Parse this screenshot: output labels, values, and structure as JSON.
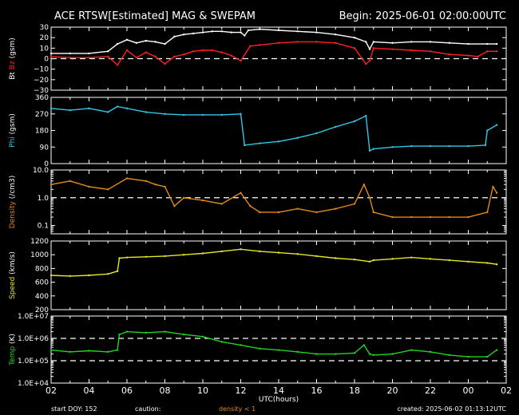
{
  "header": {
    "title": "ACE RTSW[Estimated] MAG & SWEPAM",
    "begin": "Begin: 2025-06-01 02:00:00UTC"
  },
  "footer": {
    "start": "start DOY: 152",
    "caution": "caution:",
    "caution_note": "density < 1",
    "created": "created: 2025-06-02 01:13:12UTC"
  },
  "colors": {
    "background": "#000000",
    "frame": "#ffffff",
    "bt": "#ffffff",
    "bz": "#ff2020",
    "phi": "#33c7e6",
    "density": "#e08a1a",
    "speed": "#e6e62a",
    "temp": "#22d422"
  },
  "chart_data": {
    "type": "line",
    "xlabel": "UTC(hours)",
    "xlim": [
      2,
      26
    ],
    "x_ticks": [
      "02",
      "04",
      "06",
      "08",
      "10",
      "12",
      "14",
      "16",
      "18",
      "20",
      "22",
      "00",
      "02"
    ],
    "panels": [
      {
        "id": "bt_bz",
        "ylabel_parts": [
          {
            "text": "Bt",
            "color": "#ffffff"
          },
          {
            "text": "Bz",
            "color": "#ff2020"
          },
          {
            "text": "(gsm)",
            "color": "#ffffff"
          }
        ],
        "ylim": [
          -30,
          30
        ],
        "scale": "linear",
        "ticks": [
          {
            "v": 30,
            "label": "30"
          },
          {
            "v": 20,
            "label": "20"
          },
          {
            "v": 10,
            "label": "10"
          },
          {
            "v": 0,
            "label": "0"
          },
          {
            "v": -10,
            "label": "−10"
          },
          {
            "v": -20,
            "label": "−20"
          },
          {
            "v": -30,
            "label": "−30"
          }
        ],
        "ref_lines": [
          0
        ],
        "series": [
          {
            "key": "bt",
            "color": "#ffffff",
            "points": [
              [
                2.0,
                5
              ],
              [
                3.0,
                5
              ],
              [
                4.0,
                5
              ],
              [
                5.0,
                7
              ],
              [
                5.5,
                14
              ],
              [
                6.0,
                18
              ],
              [
                6.5,
                15
              ],
              [
                7.0,
                17
              ],
              [
                7.5,
                16
              ],
              [
                8.0,
                14
              ],
              [
                8.5,
                21
              ],
              [
                9.0,
                23
              ],
              [
                9.5,
                24
              ],
              [
                10.0,
                25
              ],
              [
                10.5,
                26
              ],
              [
                11.0,
                26
              ],
              [
                11.5,
                25
              ],
              [
                12.0,
                25
              ],
              [
                12.2,
                22
              ],
              [
                12.4,
                27
              ],
              [
                13.0,
                28
              ],
              [
                14.0,
                27
              ],
              [
                15.0,
                26
              ],
              [
                16.0,
                25
              ],
              [
                17.0,
                23
              ],
              [
                18.0,
                20
              ],
              [
                18.6,
                16
              ],
              [
                18.8,
                9
              ],
              [
                19.0,
                16
              ],
              [
                20.0,
                15
              ],
              [
                21.0,
                16
              ],
              [
                22.0,
                16
              ],
              [
                23.0,
                15
              ],
              [
                24.0,
                14
              ],
              [
                25.0,
                14
              ],
              [
                25.5,
                14
              ]
            ]
          },
          {
            "key": "bz",
            "color": "#ff2020",
            "points": [
              [
                2.0,
                2
              ],
              [
                3.0,
                1
              ],
              [
                4.0,
                1
              ],
              [
                5.0,
                2
              ],
              [
                5.5,
                -6
              ],
              [
                6.0,
                8
              ],
              [
                6.5,
                1
              ],
              [
                7.0,
                6
              ],
              [
                7.5,
                2
              ],
              [
                8.0,
                -5
              ],
              [
                8.5,
                2
              ],
              [
                9.0,
                4
              ],
              [
                9.5,
                7
              ],
              [
                10.0,
                8
              ],
              [
                10.5,
                8
              ],
              [
                11.0,
                6
              ],
              [
                11.5,
                3
              ],
              [
                12.0,
                -2
              ],
              [
                12.5,
                12
              ],
              [
                13.0,
                13
              ],
              [
                14.0,
                15
              ],
              [
                15.0,
                16
              ],
              [
                16.0,
                16
              ],
              [
                17.0,
                15
              ],
              [
                18.0,
                10
              ],
              [
                18.6,
                -5
              ],
              [
                18.8,
                -2
              ],
              [
                19.0,
                10
              ],
              [
                20.0,
                9
              ],
              [
                21.0,
                8
              ],
              [
                22.0,
                7
              ],
              [
                23.0,
                4
              ],
              [
                24.0,
                3
              ],
              [
                24.5,
                2
              ],
              [
                25.0,
                7
              ],
              [
                25.5,
                7
              ]
            ]
          }
        ]
      },
      {
        "id": "phi",
        "ylabel_parts": [
          {
            "text": "Phi",
            "color": "#33c7e6"
          },
          {
            "text": "(gsm)",
            "color": "#ffffff"
          }
        ],
        "ylim": [
          0,
          360
        ],
        "scale": "linear",
        "ticks": [
          {
            "v": 360,
            "label": "360"
          },
          {
            "v": 270,
            "label": "270"
          },
          {
            "v": 180,
            "label": "180"
          },
          {
            "v": 90,
            "label": "90"
          },
          {
            "v": 0,
            "label": "0"
          }
        ],
        "ref_lines": [],
        "series": [
          {
            "key": "phi",
            "color": "#33c7e6",
            "points": [
              [
                2.0,
                300
              ],
              [
                3.0,
                290
              ],
              [
                4.0,
                300
              ],
              [
                5.0,
                280
              ],
              [
                5.5,
                310
              ],
              [
                6.0,
                300
              ],
              [
                7.0,
                280
              ],
              [
                8.0,
                270
              ],
              [
                9.0,
                265
              ],
              [
                10.0,
                265
              ],
              [
                11.0,
                265
              ],
              [
                12.0,
                270
              ],
              [
                12.2,
                100
              ],
              [
                13.0,
                110
              ],
              [
                14.0,
                120
              ],
              [
                15.0,
                140
              ],
              [
                16.0,
                165
              ],
              [
                17.0,
                200
              ],
              [
                18.0,
                230
              ],
              [
                18.6,
                260
              ],
              [
                18.8,
                70
              ],
              [
                19.0,
                80
              ],
              [
                20.0,
                90
              ],
              [
                21.0,
                95
              ],
              [
                22.0,
                95
              ],
              [
                23.0,
                95
              ],
              [
                24.0,
                95
              ],
              [
                24.9,
                100
              ],
              [
                25.0,
                180
              ],
              [
                25.5,
                210
              ]
            ]
          }
        ]
      },
      {
        "id": "density",
        "ylabel_parts": [
          {
            "text": "Density",
            "color": "#e08a1a"
          },
          {
            "text": "(/cm3)",
            "color": "#ffffff"
          }
        ],
        "ylim": [
          0.05,
          10
        ],
        "scale": "log",
        "ticks": [
          {
            "v": 10,
            "label": "10.0"
          },
          {
            "v": 1,
            "label": "1.0"
          },
          {
            "v": 0.1,
            "label": "0.1"
          }
        ],
        "ref_lines": [
          1
        ],
        "series": [
          {
            "key": "density",
            "color": "#e08a1a",
            "points": [
              [
                2.0,
                3.0
              ],
              [
                3.0,
                4.0
              ],
              [
                4.0,
                2.5
              ],
              [
                5.0,
                2.0
              ],
              [
                6.0,
                5.0
              ],
              [
                7.0,
                4.0
              ],
              [
                7.5,
                3.0
              ],
              [
                8.0,
                2.5
              ],
              [
                8.5,
                0.5
              ],
              [
                9.0,
                1.0
              ],
              [
                10.0,
                0.8
              ],
              [
                11.0,
                0.6
              ],
              [
                12.0,
                1.5
              ],
              [
                12.5,
                0.5
              ],
              [
                13.0,
                0.3
              ],
              [
                14.0,
                0.3
              ],
              [
                15.0,
                0.4
              ],
              [
                16.0,
                0.3
              ],
              [
                17.0,
                0.4
              ],
              [
                18.0,
                0.6
              ],
              [
                18.5,
                3.0
              ],
              [
                18.8,
                1.0
              ],
              [
                19.0,
                0.3
              ],
              [
                20.0,
                0.2
              ],
              [
                21.0,
                0.2
              ],
              [
                22.0,
                0.2
              ],
              [
                23.0,
                0.2
              ],
              [
                24.0,
                0.2
              ],
              [
                25.0,
                0.3
              ],
              [
                25.3,
                2.5
              ],
              [
                25.5,
                1.5
              ]
            ]
          }
        ]
      },
      {
        "id": "speed",
        "ylabel_parts": [
          {
            "text": "Speed",
            "color": "#e6e62a"
          },
          {
            "text": "(km/s)",
            "color": "#ffffff"
          }
        ],
        "ylim": [
          200,
          1200
        ],
        "scale": "linear",
        "ticks": [
          {
            "v": 1200,
            "label": "1200"
          },
          {
            "v": 1000,
            "label": "1000"
          },
          {
            "v": 800,
            "label": "800"
          },
          {
            "v": 600,
            "label": "600"
          },
          {
            "v": 400,
            "label": "400"
          },
          {
            "v": 200,
            "label": "200"
          }
        ],
        "ref_lines": [],
        "series": [
          {
            "key": "speed",
            "color": "#e6e62a",
            "points": [
              [
                2.0,
                700
              ],
              [
                3.0,
                690
              ],
              [
                4.0,
                700
              ],
              [
                5.0,
                720
              ],
              [
                5.5,
                760
              ],
              [
                5.6,
                950
              ],
              [
                6.0,
                960
              ],
              [
                7.0,
                970
              ],
              [
                8.0,
                980
              ],
              [
                9.0,
                1000
              ],
              [
                10.0,
                1020
              ],
              [
                11.0,
                1050
              ],
              [
                12.0,
                1080
              ],
              [
                13.0,
                1050
              ],
              [
                14.0,
                1030
              ],
              [
                15.0,
                1010
              ],
              [
                16.0,
                980
              ],
              [
                17.0,
                950
              ],
              [
                18.0,
                930
              ],
              [
                18.8,
                900
              ],
              [
                19.0,
                920
              ],
              [
                20.0,
                940
              ],
              [
                21.0,
                960
              ],
              [
                22.0,
                940
              ],
              [
                23.0,
                920
              ],
              [
                24.0,
                900
              ],
              [
                25.0,
                880
              ],
              [
                25.5,
                860
              ]
            ]
          }
        ]
      },
      {
        "id": "temp",
        "ylabel_parts": [
          {
            "text": "Temp",
            "color": "#22d422"
          },
          {
            "text": "(K)",
            "color": "#ffffff"
          }
        ],
        "ylim": [
          10000,
          10000000
        ],
        "scale": "log",
        "ticks": [
          {
            "v": 10000000,
            "label": "1.0E+07"
          },
          {
            "v": 1000000,
            "label": "1.0E+06"
          },
          {
            "v": 100000,
            "label": "1.0E+05"
          },
          {
            "v": 10000,
            "label": "1.0E+04"
          }
        ],
        "ref_lines": [
          1000000,
          100000
        ],
        "series": [
          {
            "key": "temp",
            "color": "#22d422",
            "points": [
              [
                2.0,
                300000
              ],
              [
                3.0,
                250000
              ],
              [
                4.0,
                280000
              ],
              [
                5.0,
                250000
              ],
              [
                5.5,
                300000
              ],
              [
                5.6,
                1500000
              ],
              [
                6.0,
                2000000
              ],
              [
                7.0,
                1800000
              ],
              [
                8.0,
                2000000
              ],
              [
                9.0,
                1500000
              ],
              [
                10.0,
                1200000
              ],
              [
                11.0,
                700000
              ],
              [
                12.0,
                500000
              ],
              [
                13.0,
                350000
              ],
              [
                14.0,
                300000
              ],
              [
                15.0,
                250000
              ],
              [
                16.0,
                200000
              ],
              [
                17.0,
                200000
              ],
              [
                18.0,
                220000
              ],
              [
                18.5,
                500000
              ],
              [
                18.8,
                200000
              ],
              [
                19.0,
                180000
              ],
              [
                20.0,
                200000
              ],
              [
                21.0,
                300000
              ],
              [
                22.0,
                250000
              ],
              [
                23.0,
                180000
              ],
              [
                24.0,
                150000
              ],
              [
                25.0,
                150000
              ],
              [
                25.5,
                300000
              ]
            ]
          }
        ]
      }
    ]
  }
}
